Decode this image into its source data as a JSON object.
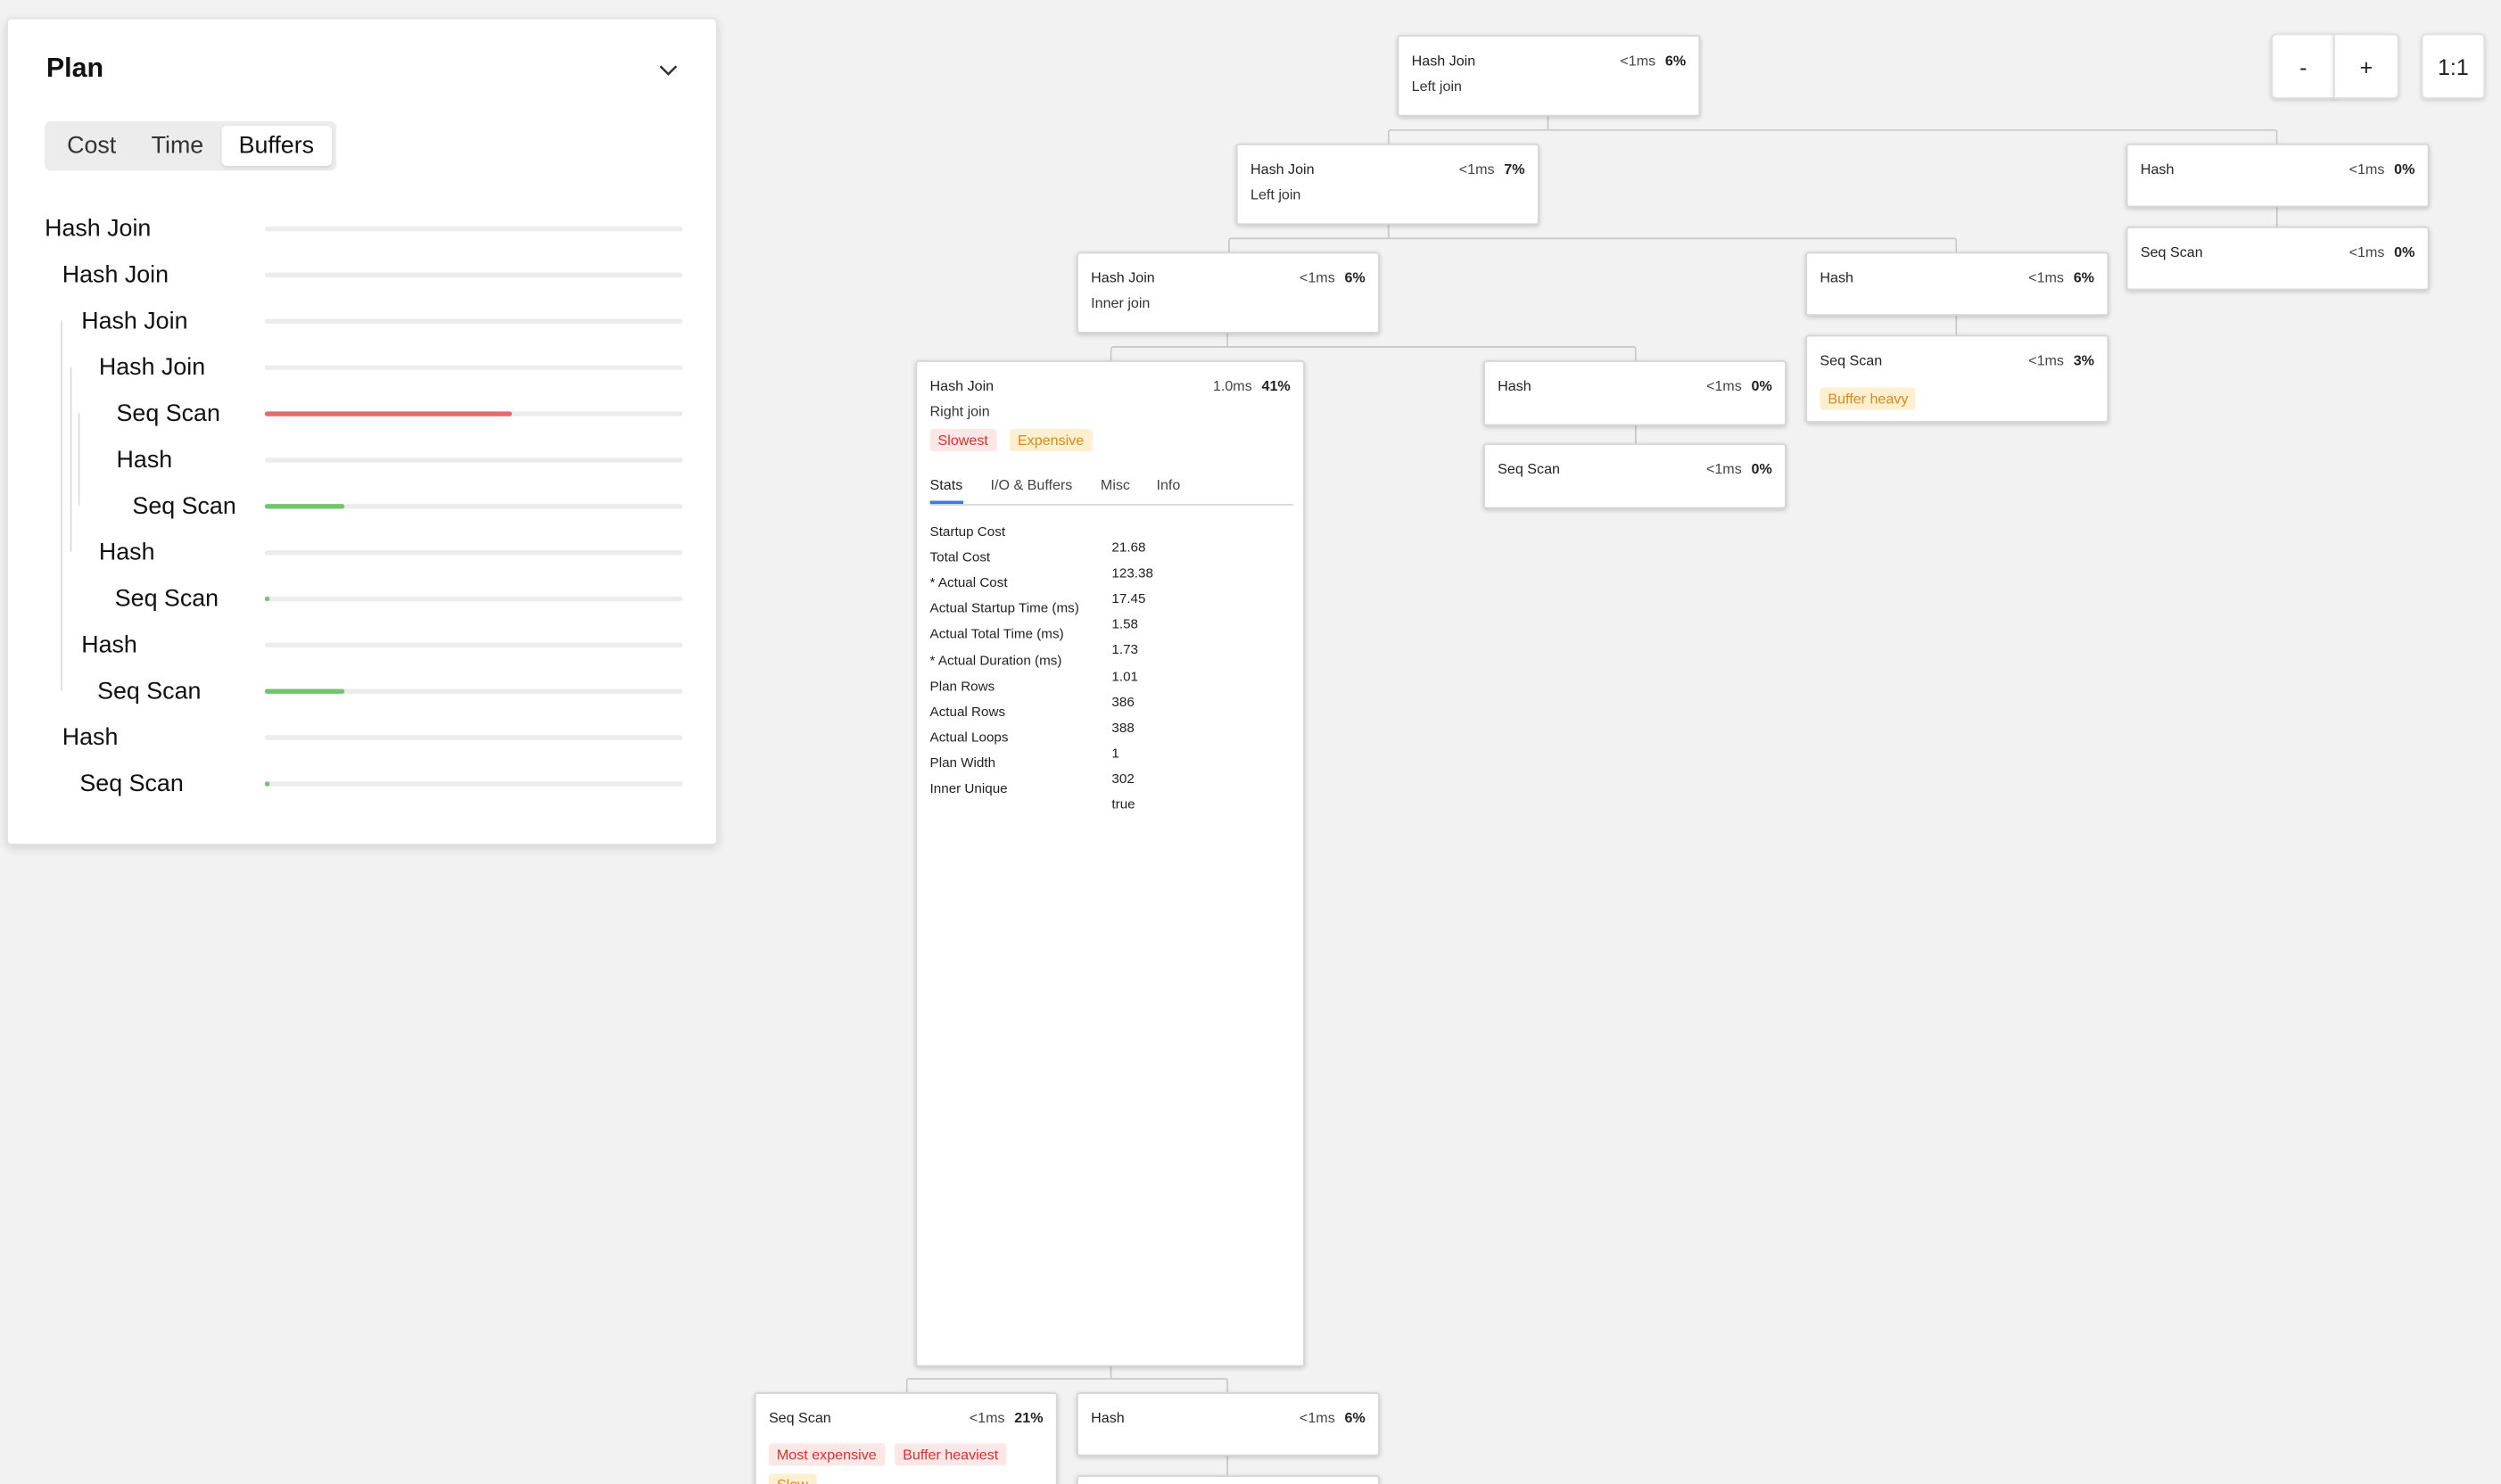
{
  "panel": {
    "title": "Plan",
    "tabs": [
      "Cost",
      "Time",
      "Buffers"
    ],
    "active_tab": "Buffers",
    "rows": [
      {
        "label": "Hash Join",
        "value": 0
      },
      {
        "label": "Hash Join",
        "value": 0
      },
      {
        "label": "Hash Join",
        "value": 0
      },
      {
        "label": "Hash Join",
        "value": 0
      },
      {
        "label": "Seq Scan",
        "value": 0.59
      },
      {
        "label": "Hash",
        "value": 0
      },
      {
        "label": "Seq Scan",
        "value": 0.19
      },
      {
        "label": "Hash",
        "value": 0
      },
      {
        "label": "Seq Scan",
        "value": 0.01
      },
      {
        "label": "Hash",
        "value": 0
      },
      {
        "label": "Seq Scan",
        "value": 0.19
      },
      {
        "label": "Hash",
        "value": 0
      },
      {
        "label": "Seq Scan",
        "value": 0.01
      }
    ],
    "bar_colors": {
      "high": "#e56a6a",
      "low": "#72c56e"
    }
  },
  "zoom": {
    "out_label": "-",
    "in_label": "+",
    "reset_label": "1:1"
  },
  "nodes": {
    "root": {
      "title": "Hash Join",
      "time": "<1ms",
      "pct": "6%",
      "sub": "Left join"
    },
    "hj2": {
      "title": "Hash Join",
      "time": "<1ms",
      "pct": "7%",
      "sub": "Left join"
    },
    "hashA": {
      "title": "Hash",
      "time": "<1ms",
      "pct": "0%"
    },
    "seqA": {
      "title": "Seq Scan",
      "time": "<1ms",
      "pct": "0%"
    },
    "hj3": {
      "title": "Hash Join",
      "time": "<1ms",
      "pct": "6%",
      "sub": "Inner join"
    },
    "hashB": {
      "title": "Hash",
      "time": "<1ms",
      "pct": "6%"
    },
    "seqB": {
      "title": "Seq Scan",
      "time": "<1ms",
      "pct": "3%",
      "tags": [
        "Buffer heavy"
      ]
    },
    "hj4": {
      "title": "Hash Join",
      "time": "1.0ms",
      "pct": "41%",
      "sub": "Right join",
      "tags": [
        "Slowest",
        "Expensive"
      ],
      "tabs": [
        "Stats",
        "I/O & Buffers",
        "Misc",
        "Info"
      ],
      "active_tab": "Stats",
      "stats": [
        {
          "k": "Startup Cost",
          "v": "21.68"
        },
        {
          "k": "Total Cost",
          "v": "123.38"
        },
        {
          "k": "* Actual Cost",
          "v": "17.45"
        },
        {
          "k": "Actual Startup Time (ms)",
          "v": "1.58"
        },
        {
          "k": "Actual Total Time (ms)",
          "v": "1.73"
        },
        {
          "k": "* Actual Duration (ms)",
          "v": "1.01"
        },
        {
          "k": "Plan Rows",
          "v": "386"
        },
        {
          "k": "Actual Rows",
          "v": "388"
        },
        {
          "k": "Actual Loops",
          "v": "1"
        },
        {
          "k": "Plan Width",
          "v": "302"
        },
        {
          "k": "Inner Unique",
          "v": "true"
        }
      ]
    },
    "hashC": {
      "title": "Hash",
      "time": "<1ms",
      "pct": "0%"
    },
    "seqC": {
      "title": "Seq Scan",
      "time": "<1ms",
      "pct": "0%"
    },
    "seqD": {
      "title": "Seq Scan",
      "time": "<1ms",
      "pct": "21%",
      "tags": [
        "Most expensive",
        "Buffer heaviest",
        "Slow"
      ]
    },
    "hashD": {
      "title": "Hash",
      "time": "<1ms",
      "pct": "6%"
    }
  }
}
